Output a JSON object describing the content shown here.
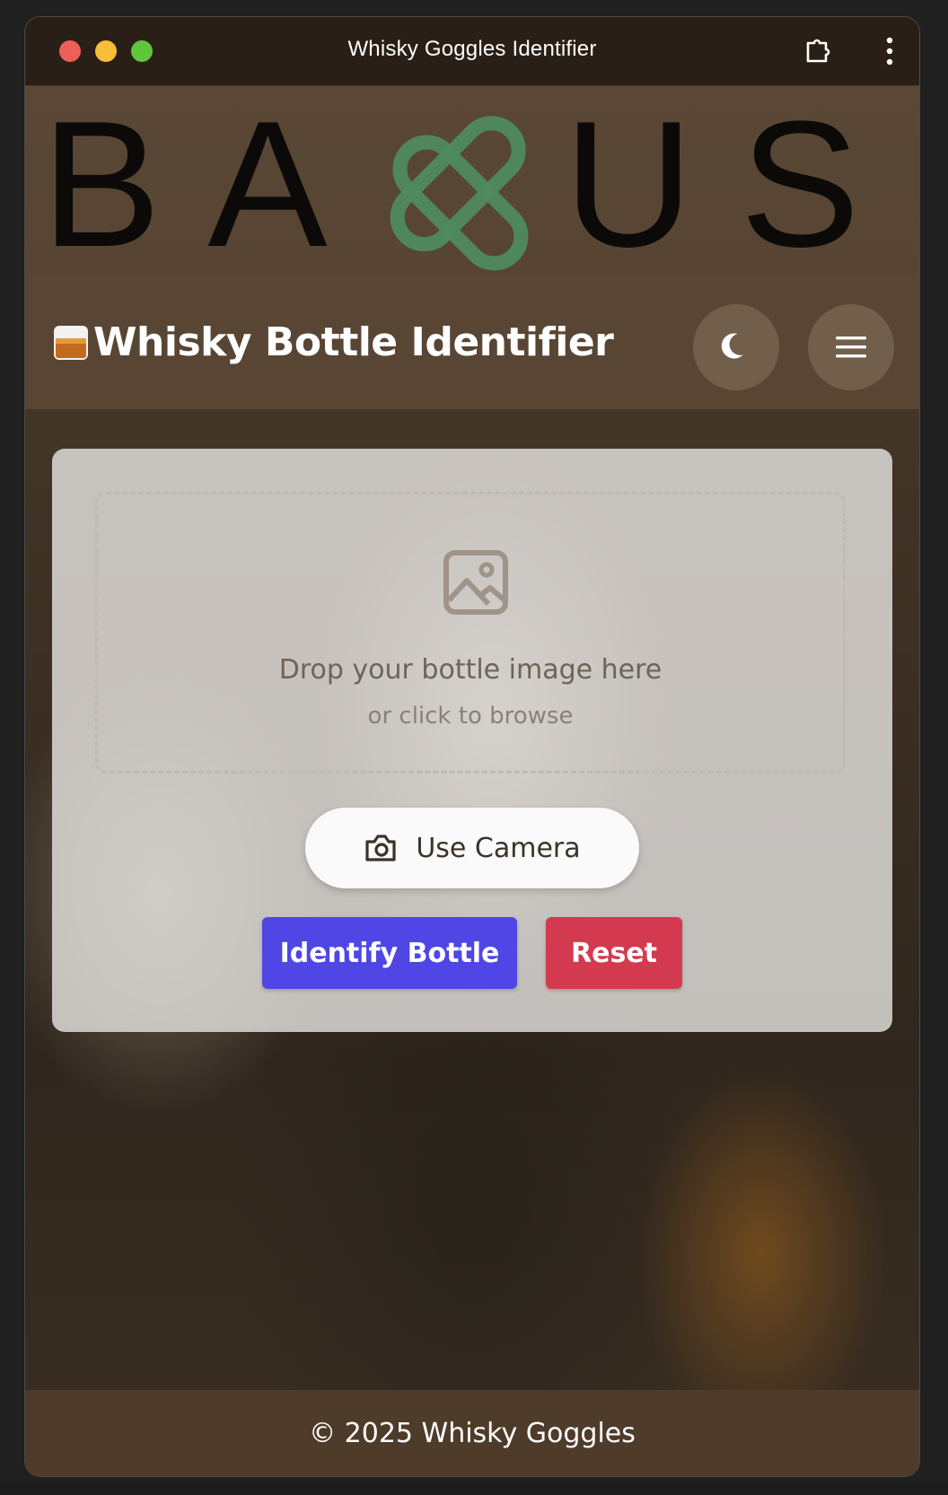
{
  "window": {
    "title": "Whisky Goggles Identifier"
  },
  "logo": {
    "text_left": "BA",
    "text_right": "US",
    "accent_color": "#4f8a5f"
  },
  "header": {
    "title": "Whisky Bottle Identifier",
    "emoji_icon": "tumbler-glass-icon",
    "theme_toggle_icon": "moon-icon",
    "menu_icon": "hamburger-menu-icon"
  },
  "upload": {
    "dropzone_title": "Drop your bottle image here",
    "dropzone_subtitle": "or click to browse",
    "camera_label": "Use Camera"
  },
  "actions": {
    "identify_label": "Identify Bottle",
    "reset_label": "Reset",
    "identify_color": "#4f46e5",
    "reset_color": "#d43a4f"
  },
  "footer": {
    "copyright": "© 2025 Whisky Goggles"
  }
}
